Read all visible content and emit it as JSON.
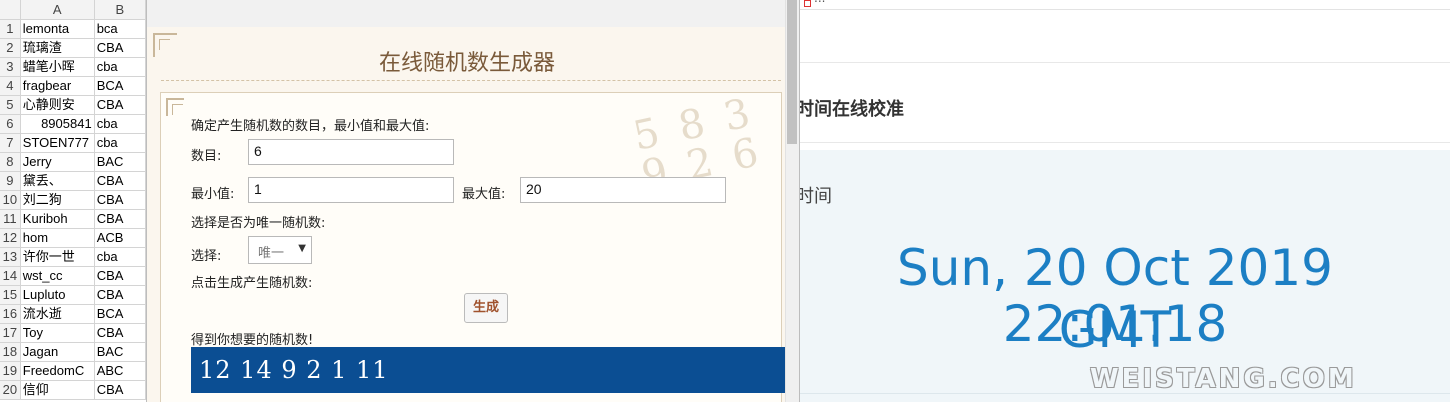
{
  "spreadsheet": {
    "columns": [
      "A",
      "B"
    ],
    "rows": [
      {
        "n": "1",
        "a": "lemonta",
        "b": "bca"
      },
      {
        "n": "2",
        "a": "琉璃渣",
        "b": "CBA"
      },
      {
        "n": "3",
        "a": "蜡笔小晖",
        "b": "cba"
      },
      {
        "n": "4",
        "a": "fragbear",
        "b": "BCA"
      },
      {
        "n": "5",
        "a": "心静则安",
        "b": "CBA"
      },
      {
        "n": "6",
        "a": "8905841",
        "b": "cba"
      },
      {
        "n": "7",
        "a": "STOEN777",
        "b": "cba"
      },
      {
        "n": "8",
        "a": "Jerry",
        "b": "BAC"
      },
      {
        "n": "9",
        "a": "黛丢、",
        "b": "CBA"
      },
      {
        "n": "10",
        "a": "刘二狗",
        "b": "CBA"
      },
      {
        "n": "11",
        "a": "Kuriboh",
        "b": "CBA"
      },
      {
        "n": "12",
        "a": "hom",
        "b": "ACB"
      },
      {
        "n": "13",
        "a": "许你一世",
        "b": "cba"
      },
      {
        "n": "14",
        "a": "wst_cc",
        "b": "CBA"
      },
      {
        "n": "15",
        "a": "Lupluto",
        "b": "CBA"
      },
      {
        "n": "16",
        "a": "流水逝",
        "b": "BCA"
      },
      {
        "n": "17",
        "a": "Toy",
        "b": "CBA"
      },
      {
        "n": "18",
        "a": "Jagan",
        "b": "BAC"
      },
      {
        "n": "19",
        "a": "FreedomC",
        "b": "ABC"
      },
      {
        "n": "20",
        "a": "信仰",
        "b": "CBA"
      }
    ]
  },
  "generator": {
    "title": "在线随机数生成器",
    "instruction": "确定产生随机数的数目，最小值和最大值:",
    "count_label": "数目:",
    "count_value": "6",
    "min_label": "最小值:",
    "min_value": "1",
    "max_label": "最大值:",
    "max_value": "20",
    "unique_prompt": "选择是否为唯一随机数:",
    "select_label": "选择:",
    "select_value": "唯一",
    "click_prompt": "点击生成产生随机数:",
    "generate_label": "生成",
    "result_prompt": "得到你想要的随机数!",
    "result_value": "12  14  9  2  1  11",
    "deco_text": "5 8 3 9 2 6"
  },
  "page": {
    "url_fragment": "...",
    "heading": "时间在线校准",
    "sublabel": "时间",
    "time_line1": "Sun, 20 Oct 2019 22:01:18",
    "time_line2": "GMT",
    "watermark": "WEISTANG.COM"
  },
  "colors": {
    "result_bg": "#0b4e93",
    "time_blue": "#1c7fc4",
    "title_brown": "#7a5a3a"
  }
}
